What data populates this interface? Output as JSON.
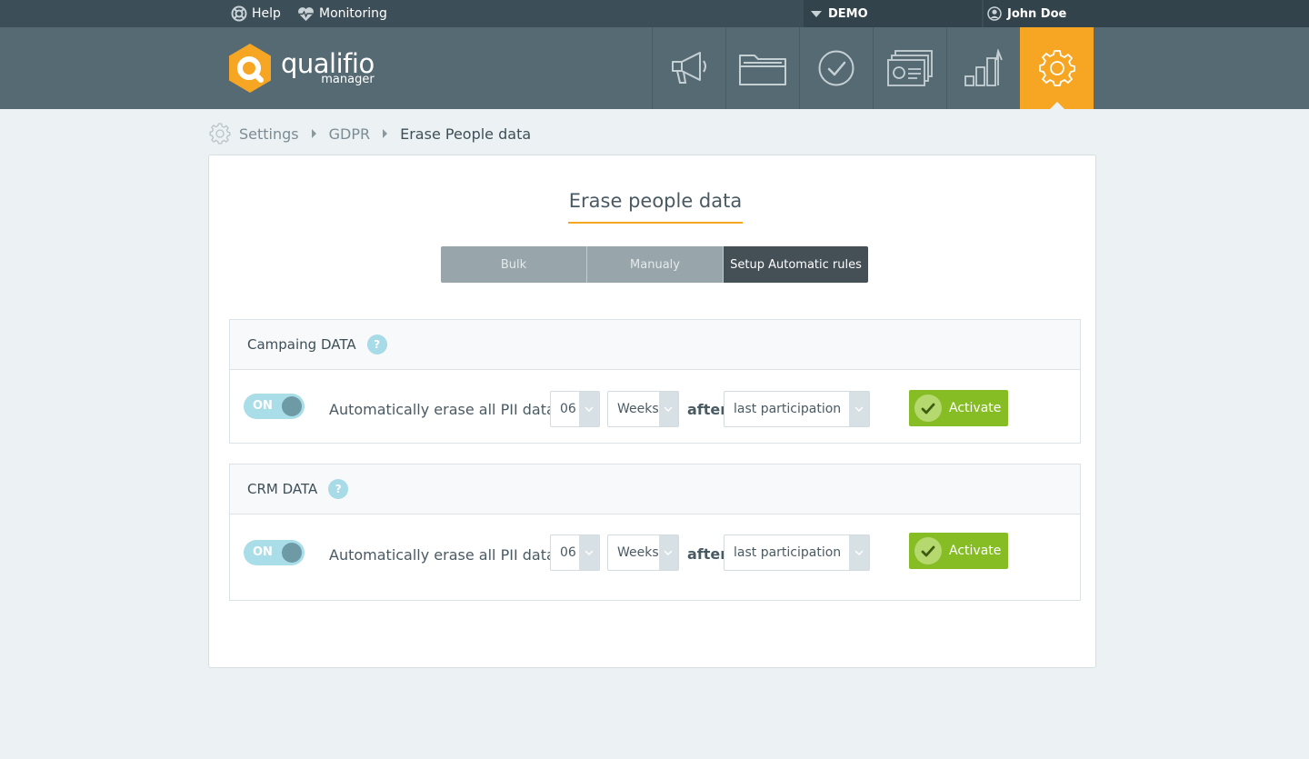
{
  "topbar": {
    "help_label": "Help",
    "monitoring_label": "Monitoring",
    "account_selected": "DEMO",
    "user_name": "John Doe"
  },
  "logo": {
    "main": "qualifio",
    "sub": "manager"
  },
  "nav": {
    "items": [
      {
        "icon": "megaphone-icon",
        "active": false
      },
      {
        "icon": "folder-icon",
        "active": false
      },
      {
        "icon": "check-circle-icon",
        "active": false
      },
      {
        "icon": "contact-cards-icon",
        "active": false
      },
      {
        "icon": "bar-chart-icon",
        "active": false
      },
      {
        "icon": "gear-icon",
        "active": true
      }
    ],
    "active_color": "#f6a623"
  },
  "breadcrumb": {
    "items": [
      "Settings",
      "GDPR",
      "Erase People data"
    ]
  },
  "page": {
    "title": "Erase people data",
    "tabs": [
      {
        "label": "Bulk",
        "active": false
      },
      {
        "label": "Manualy",
        "active": false
      },
      {
        "label": "Setup Automatic rules",
        "active": true
      }
    ]
  },
  "panels": [
    {
      "title": "Campaing DATA",
      "help": "?",
      "toggle": "ON",
      "rule_text": "Automatically erase all PII data",
      "amount": "06",
      "unit": "Weeks",
      "after_label": "after",
      "event": "last participation",
      "button": "Activate"
    },
    {
      "title": "CRM DATA",
      "help": "?",
      "toggle": "ON",
      "rule_text": "Automatically erase all PII data",
      "amount": "06",
      "unit": "Weeks",
      "after_label": "after",
      "event": "last participation",
      "button": "Activate"
    }
  ],
  "colors": {
    "accent": "#f6a623",
    "activate": "#86bd25",
    "toggle_on": "#a9dde8"
  }
}
